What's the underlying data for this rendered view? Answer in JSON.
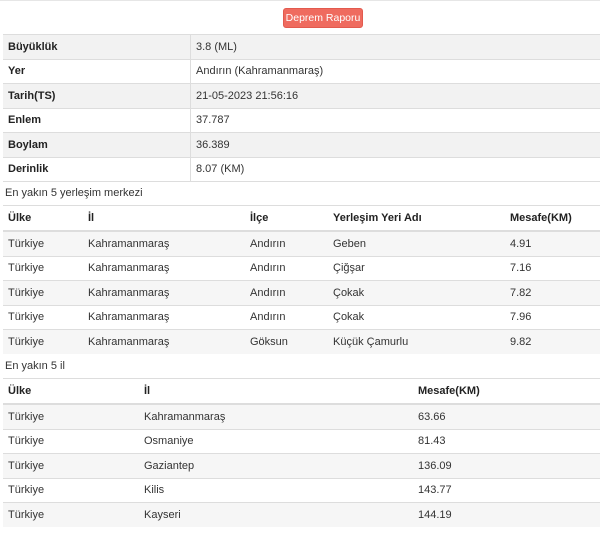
{
  "report_button": "Deprem Raporu",
  "info_rows": [
    {
      "key": "Büyüklük",
      "value": "3.8 (ML)"
    },
    {
      "key": "Yer",
      "value": "Andırın (Kahramanmaraş)"
    },
    {
      "key": "Tarih(TS)",
      "value": "21-05-2023 21:56:16"
    },
    {
      "key": "Enlem",
      "value": "37.787"
    },
    {
      "key": "Boylam",
      "value": "36.389"
    },
    {
      "key": "Derinlik",
      "value": "8.07 (KM)"
    }
  ],
  "settlements": {
    "title": "En yakın 5 yerleşim merkezi",
    "headers": [
      "Ülke",
      "İl",
      "İlçe",
      "Yerleşim Yeri Adı",
      "Mesafe(KM)"
    ],
    "rows": [
      [
        "Türkiye",
        "Kahramanmaraş",
        "Andırın",
        "Geben",
        "4.91"
      ],
      [
        "Türkiye",
        "Kahramanmaraş",
        "Andırın",
        "Çiğşar",
        "7.16"
      ],
      [
        "Türkiye",
        "Kahramanmaraş",
        "Andırın",
        "Çokak",
        "7.82"
      ],
      [
        "Türkiye",
        "Kahramanmaraş",
        "Andırın",
        "Çokak",
        "7.96"
      ],
      [
        "Türkiye",
        "Kahramanmaraş",
        "Göksun",
        "Küçük Çamurlu",
        "9.82"
      ]
    ]
  },
  "provinces": {
    "title": "En yakın 5 il",
    "headers": [
      "Ülke",
      "İl",
      "Mesafe(KM)"
    ],
    "rows": [
      [
        "Türkiye",
        "Kahramanmaraş",
        "63.66"
      ],
      [
        "Türkiye",
        "Osmaniye",
        "81.43"
      ],
      [
        "Türkiye",
        "Gaziantep",
        "136.09"
      ],
      [
        "Türkiye",
        "Kilis",
        "143.77"
      ],
      [
        "Türkiye",
        "Kayseri",
        "144.19"
      ]
    ]
  }
}
